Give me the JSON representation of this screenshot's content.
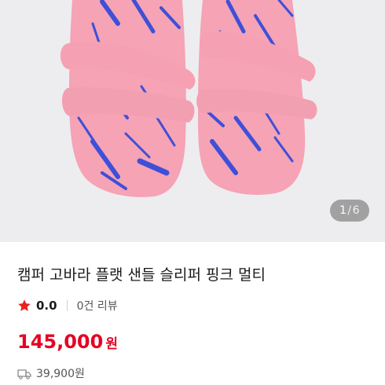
{
  "product": {
    "image_alt": "캠퍼 고바라 플랫 샌들 슬리퍼 핑크 멀티",
    "pager": {
      "current": "1",
      "separator": "/",
      "total": "6"
    },
    "title": "캠퍼 고바라 플랫 샌들 슬리퍼 핑크 멀티",
    "rating": {
      "score": "0.0",
      "review_count": "0건 리뷰"
    },
    "price": {
      "amount": "145,000",
      "unit": "원"
    },
    "shipping": {
      "fee": "39,900원",
      "icon": "truck-icon"
    }
  },
  "colors": {
    "price_red": "#e60023",
    "star_red": "#e8231f",
    "sandal_pink": "#f5a3b5",
    "pattern_blue": "#3f4fd8",
    "background_gray": "#ededef"
  }
}
